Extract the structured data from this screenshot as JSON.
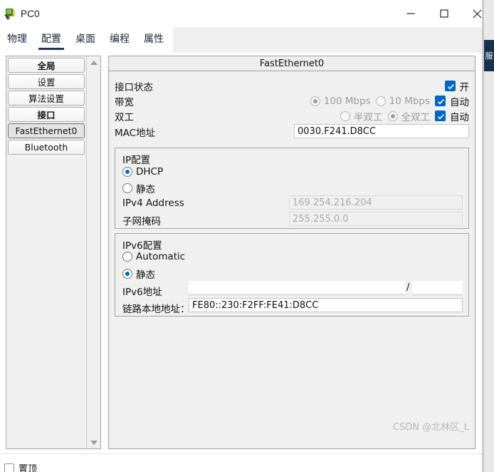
{
  "window": {
    "title": "PC0",
    "icon": "pc-device-icon",
    "minimize_label": "—",
    "maximize_label": "□",
    "close_label": "✕"
  },
  "tabs": [
    {
      "label": "物理",
      "name": "tab-physical",
      "active": false
    },
    {
      "label": "配置",
      "name": "tab-config",
      "active": true
    },
    {
      "label": "桌面",
      "name": "tab-desktop",
      "active": false
    },
    {
      "label": "编程",
      "name": "tab-programming",
      "active": false
    },
    {
      "label": "属性",
      "name": "tab-attributes",
      "active": false
    }
  ],
  "sidebar": {
    "items": [
      {
        "label": "全局",
        "bold": true,
        "selected": false,
        "name": "sidebar-item-global"
      },
      {
        "label": "设置",
        "bold": false,
        "selected": false,
        "name": "sidebar-item-settings"
      },
      {
        "label": "算法设置",
        "bold": false,
        "selected": false,
        "name": "sidebar-item-algorithm-settings"
      },
      {
        "label": "接口",
        "bold": true,
        "selected": false,
        "name": "sidebar-item-interfaces"
      },
      {
        "label": "FastEthernet0",
        "bold": false,
        "selected": true,
        "name": "sidebar-item-fastethernet0"
      },
      {
        "label": "Bluetooth",
        "bold": false,
        "selected": false,
        "name": "sidebar-item-bluetooth"
      }
    ]
  },
  "panel": {
    "title": "FastEthernet0",
    "port_status": {
      "label": "接口状态",
      "on_label": "开",
      "on_checked": true
    },
    "bandwidth": {
      "label": "带宽",
      "option_100": "100 Mbps",
      "option_100_selected": true,
      "option_10": "10 Mbps",
      "option_10_selected": false,
      "auto_label": "自动",
      "auto_checked": true,
      "disabled": true
    },
    "duplex": {
      "label": "双工",
      "option_half": "半双工",
      "option_half_selected": false,
      "option_full": "全双工",
      "option_full_selected": true,
      "auto_label": "自动",
      "auto_checked": true,
      "disabled": true
    },
    "mac": {
      "label": "MAC地址",
      "value": "0030.F241.D8CC"
    },
    "ip_config": {
      "legend": "IP配置",
      "dhcp_label": "DHCP",
      "dhcp_selected": true,
      "static_label": "静态",
      "static_selected": false,
      "ipv4_label": "IPv4 Address",
      "ipv4_value": "169.254.216.204",
      "ipv4_disabled": true,
      "mask_label": "子网掩码",
      "mask_value": "255.255.0.0",
      "mask_disabled": true
    },
    "ipv6_config": {
      "legend": "IPv6配置",
      "automatic_label": "Automatic",
      "automatic_selected": false,
      "static_label": "静态",
      "static_selected": true,
      "address_label": "IPv6地址",
      "address_value": "",
      "slash": "/",
      "prefix_value": "",
      "link_local_label": "链路本地地址：",
      "link_local_value": "FE80::230:F2FF:FE41:D8CC"
    }
  },
  "watermark": "CSDN @北林区_L",
  "bottom": {
    "always_on_top_label": "置顶",
    "always_on_top_checked": false
  },
  "edge_tab": {
    "label": "服"
  },
  "colors": {
    "accent": "#0067c0",
    "tab_underline": "#1d3557",
    "panel_bg": "#f0f0f0",
    "disabled_text": "#a8a8a8",
    "edge_tab_bg": "#16314f"
  }
}
